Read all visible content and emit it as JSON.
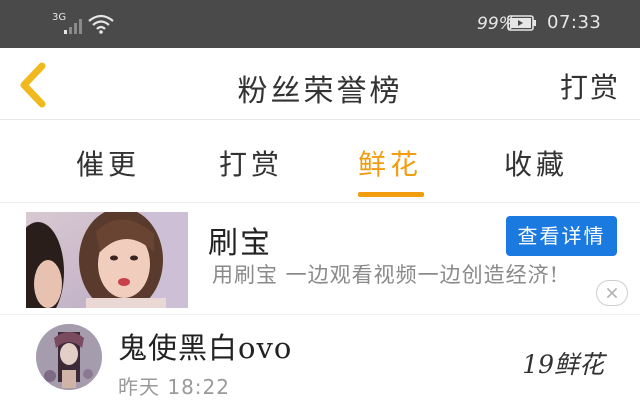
{
  "status_bar": {
    "network": "3G",
    "battery_percent": "99%",
    "time": "07:33",
    "icons": [
      "signal-icon",
      "wifi-icon",
      "battery-icon"
    ]
  },
  "header": {
    "title": "粉丝荣誉榜",
    "action": "打赏",
    "back_icon": "chevron-left-icon",
    "accent_color": "#f0b91e"
  },
  "tabs": {
    "items": [
      "催更",
      "打赏",
      "鲜花",
      "收藏"
    ],
    "active_index": 2,
    "active_color": "#f29c10"
  },
  "ad": {
    "name": "刷宝",
    "description": "用刷宝 一边观看视频一边创造经济!",
    "button": "查看详情",
    "button_color": "#1a7ae0"
  },
  "list": [
    {
      "name": "鬼使黑白ovo",
      "time": "昨天 18:22",
      "count": "19鲜花"
    }
  ]
}
